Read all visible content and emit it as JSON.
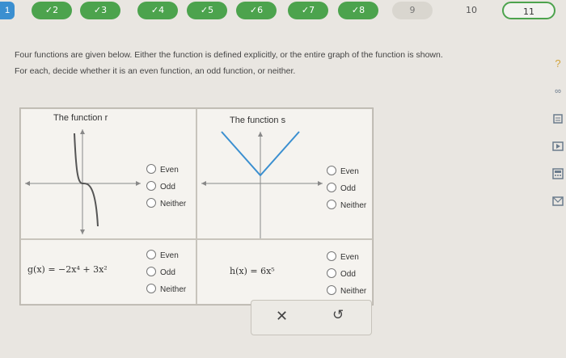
{
  "questions": {
    "first": "1",
    "pills": [
      "✓2",
      "✓3",
      "✓4",
      "✓5",
      "✓6",
      "✓7",
      "✓8",
      "9",
      "10",
      "11"
    ]
  },
  "prompt": {
    "line1": "Four functions are given below. Either the function is defined explicitly, or the entire graph of the function is shown.",
    "line2": "For each, decide whether it is an even function, an odd function, or neither."
  },
  "cells": {
    "r": {
      "title": "The function r",
      "options": [
        "Even",
        "Odd",
        "Neither"
      ]
    },
    "s": {
      "title": "The function s",
      "options": [
        "Even",
        "Odd",
        "Neither"
      ]
    },
    "g": {
      "formula": "g(x) = −2x⁴ + 3x²",
      "options": [
        "Even",
        "Odd",
        "Neither"
      ]
    },
    "h": {
      "formula": "h(x) = 6x⁵",
      "options": [
        "Even",
        "Odd",
        "Neither"
      ]
    }
  },
  "toolbar": {
    "help": "?",
    "infinity": "∞",
    "tools": [
      "book-icon",
      "video-icon",
      "calculator-icon",
      "mail-icon"
    ]
  },
  "actions": {
    "clear": "✕",
    "undo": "↺"
  }
}
